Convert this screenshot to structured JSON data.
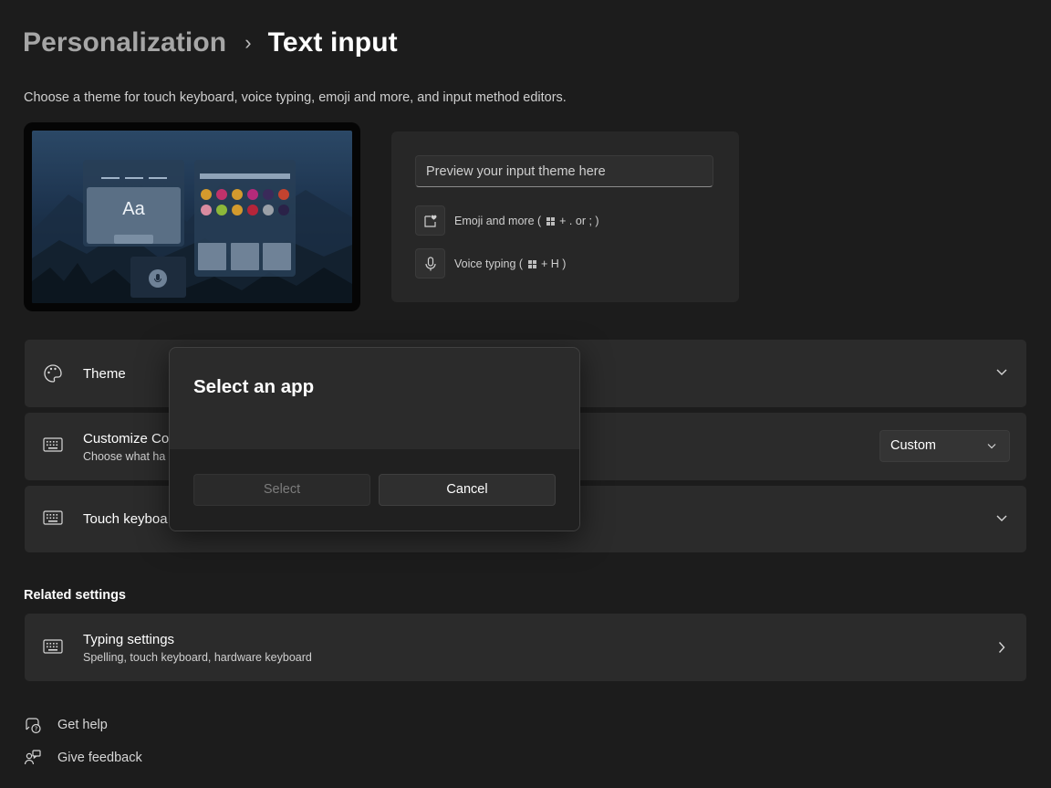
{
  "header": {
    "breadcrumb_parent": "Personalization",
    "breadcrumb_separator": "›",
    "breadcrumb_current": "Text input",
    "description": "Choose a theme for touch keyboard, voice typing, emoji and more, and input method editors."
  },
  "theme_preview": {
    "sample_text": "Aa",
    "swatch_colors": [
      "#d39a2d",
      "#c0326b",
      "#d39a2d",
      "#b42a7a",
      "#3a2a5a",
      "#c4432f",
      "#d98ba0",
      "#8db83a",
      "#d39a2d",
      "#b5253a",
      "#9aa0a8",
      "#2a2248"
    ]
  },
  "input_preview": {
    "placeholder": "Preview your input theme here",
    "emoji_label": "Emoji and more (",
    "emoji_keys": " + . or ; )",
    "voice_label": "Voice typing (",
    "voice_keys": " + H )"
  },
  "settings": {
    "theme": {
      "title": "Theme"
    },
    "customize": {
      "title": "Customize Co",
      "subtitle": "Choose what ha",
      "dropdown_value": "Custom"
    },
    "touch_keyboard": {
      "title": "Touch keyboa"
    }
  },
  "related": {
    "heading": "Related settings",
    "typing": {
      "title": "Typing settings",
      "subtitle": "Spelling, touch keyboard, hardware keyboard"
    }
  },
  "footer": {
    "help": "Get help",
    "feedback": "Give feedback"
  },
  "dialog": {
    "title": "Select an app",
    "select_label": "Select",
    "cancel_label": "Cancel"
  },
  "colors": {
    "background": "#1c1c1c",
    "card": "#2b2b2b",
    "dialog": "#2b2b2b",
    "dialog_footer": "#202020"
  }
}
